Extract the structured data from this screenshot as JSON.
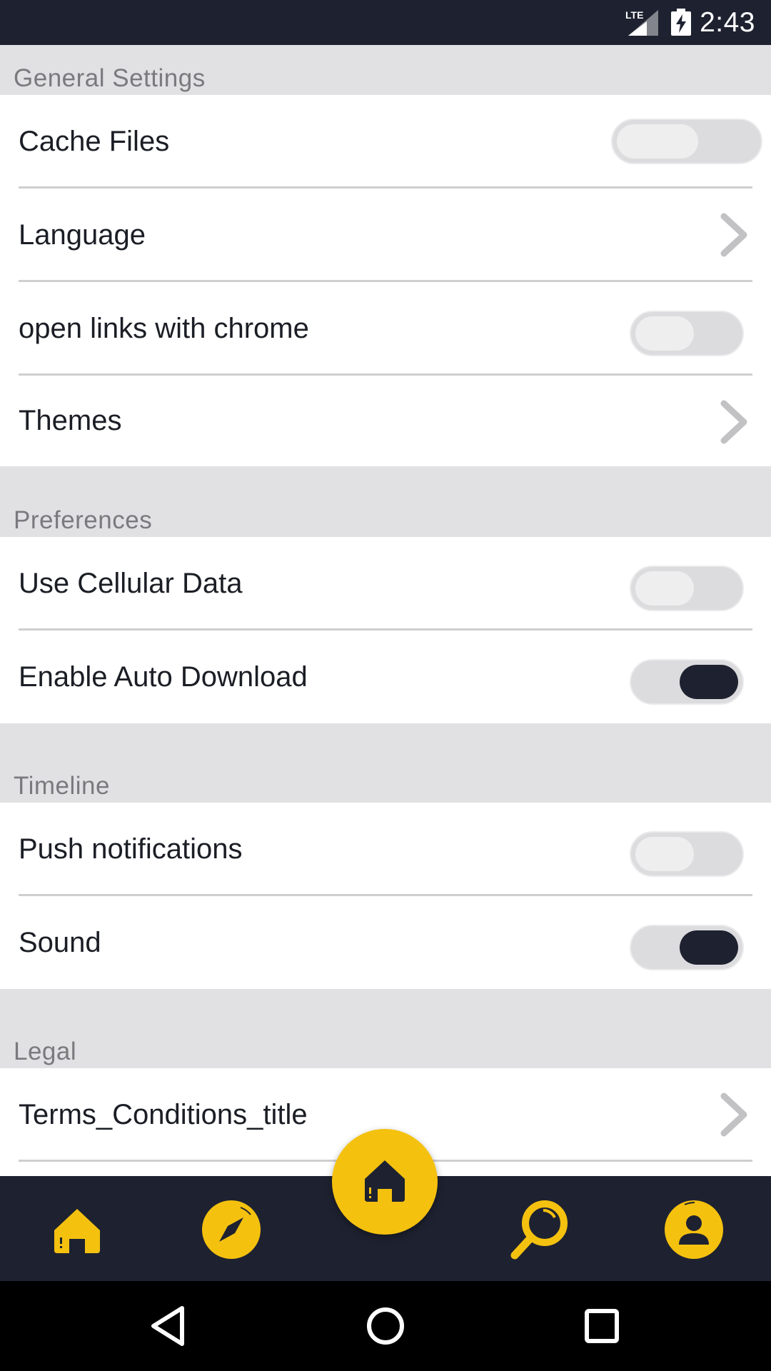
{
  "status_bar": {
    "network_label": "LTE",
    "time": "2:43",
    "icons": [
      "signal-lte-icon",
      "battery-charging-icon"
    ]
  },
  "sections": {
    "general": {
      "title": "General Settings",
      "cache_files": {
        "label": "Cache Files",
        "enabled": false
      },
      "language": {
        "label": "Language"
      },
      "open_links": {
        "label": "open links with chrome",
        "enabled": false
      },
      "themes": {
        "label": "Themes"
      }
    },
    "preferences": {
      "title": "Preferences",
      "cellular": {
        "label": "Use Cellular Data",
        "enabled": false
      },
      "auto_download": {
        "label": "Enable Auto Download",
        "enabled": true
      }
    },
    "timeline": {
      "title": "Timeline",
      "push": {
        "label": "Push notifications",
        "enabled": false
      },
      "sound": {
        "label": "Sound",
        "enabled": true
      }
    },
    "legal": {
      "title": "Legal",
      "terms": {
        "label": "Terms_Conditions_title"
      }
    }
  },
  "bottom_nav": {
    "items": [
      "home-icon",
      "compass-icon",
      "center-home-icon",
      "search-icon",
      "profile-icon"
    ],
    "accent_color": "#f4c10f",
    "background_color": "#1e2230"
  },
  "system_nav": {
    "items": [
      "back-icon",
      "home-circle-icon",
      "recents-icon"
    ]
  }
}
